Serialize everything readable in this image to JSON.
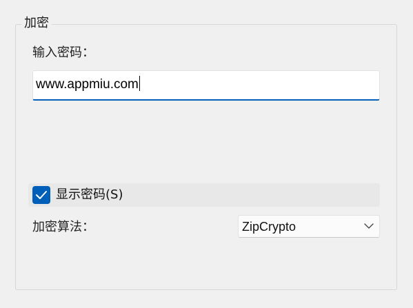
{
  "encryption": {
    "group_title": "加密",
    "password_label": "输入密码：",
    "password_value": "www.appmiu.com",
    "show_password": {
      "label": "显示密码(S)",
      "checked": true
    },
    "method_label": "加密算法：",
    "method_selected": "ZipCrypto",
    "method_options": [
      "ZipCrypto"
    ]
  },
  "icons": {
    "checkbox": "checkmark-icon",
    "dropdown": "chevron-down-icon"
  },
  "colors": {
    "accent": "#005fb8",
    "background": "#f0f0f0"
  }
}
